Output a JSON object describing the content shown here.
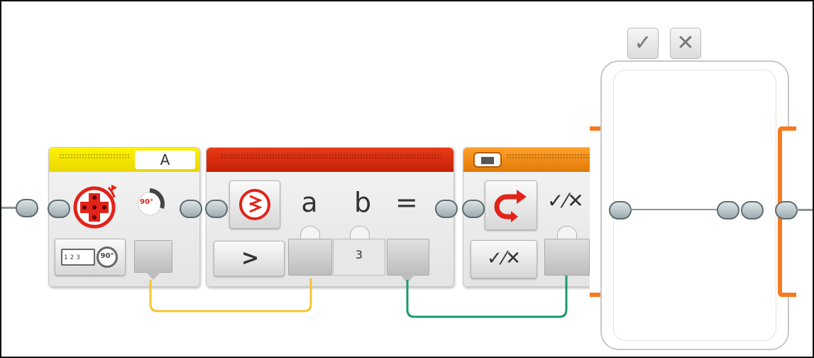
{
  "motor_block": {
    "port_letter": "A",
    "degrees_badge": "90°",
    "mode_ruler_digits": "1 2 3",
    "mode_degrees_badge": "90°",
    "header_color": "#f2e400",
    "icon_color": "#e2231a"
  },
  "compare_block": {
    "input_a_label": "a",
    "input_b_label": "b",
    "output_label": "=",
    "operator_symbol": ">",
    "input_b_value": "3",
    "header_color": "#d42a10"
  },
  "switch_block": {
    "true_tab_symbol": "✓",
    "false_tab_symbol": "✕",
    "mode_symbol": "✓⁄✕",
    "output_symbol": "✓⁄✕",
    "header_color": "#f08a14",
    "frame_color": "#f47b20"
  },
  "wires": {
    "motor_to_compare_color": "#f4c430",
    "compare_to_switch_color": "#1a9a6a"
  },
  "icons": [
    "motor-cross-icon",
    "degrees-dial-icon",
    "ruler-icon",
    "compare-icon",
    "loop-arrow-icon",
    "check-cross-icon"
  ]
}
